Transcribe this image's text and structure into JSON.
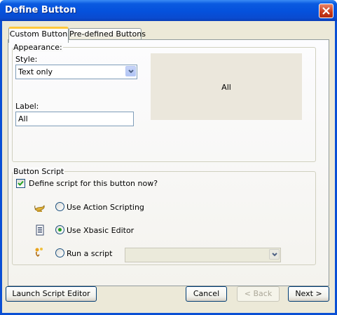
{
  "window": {
    "title": "Define Button"
  },
  "tabs": [
    {
      "label": "Custom Button",
      "active": true
    },
    {
      "label": "Pre-defined Buttons",
      "active": false
    }
  ],
  "appearance": {
    "group_label": "Appearance:",
    "style_label": "Style:",
    "style_value": "Text only",
    "label_label": "Label:",
    "label_value": "All",
    "preview_text": "All"
  },
  "script": {
    "group_label": "Button Script",
    "define_checkbox_label": "Define script for this button now?",
    "define_checked": true,
    "options": [
      {
        "label": "Use Action Scripting",
        "icon": "genie-lamp-icon",
        "selected": false
      },
      {
        "label": "Use Xbasic Editor",
        "icon": "xbasic-editor-icon",
        "selected": true
      },
      {
        "label": "Run a script",
        "icon": "run-script-icon",
        "selected": false
      }
    ],
    "script_select_value": ""
  },
  "buttons": {
    "launch": "Launch Script Editor",
    "cancel": "Cancel",
    "back": "< Back",
    "next": "Next >"
  },
  "colors": {
    "titlebar": "#0a5ae0",
    "dialog_bg": "#ece9d8",
    "tab_highlight": "#ffc83c",
    "radio_selected": "#21a121"
  }
}
